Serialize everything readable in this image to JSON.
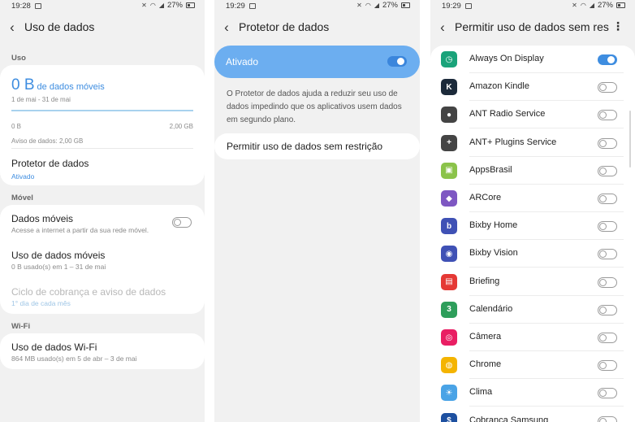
{
  "panel1": {
    "status": {
      "time": "19:28",
      "battery": "27%"
    },
    "title": "Uso de dados",
    "section_uso": "Uso",
    "usage": {
      "amount": "0 B",
      "unit_label": "de dados móveis",
      "period": "1 de mai - 31 de mai",
      "min_label": "0 B",
      "max_label": "2,00 GB",
      "warning": "Aviso de dados: 2,00 GB"
    },
    "protetor": {
      "title": "Protetor de dados",
      "status": "Ativado"
    },
    "section_movel": "Móvel",
    "dados_moveis": {
      "title": "Dados móveis",
      "subtitle": "Acesse a internet a partir da sua rede móvel.",
      "enabled": false
    },
    "uso_moveis": {
      "title": "Uso de dados móveis",
      "subtitle": "0 B usado(s) em 1 – 31 de mai"
    },
    "ciclo": {
      "title": "Ciclo de cobrança e aviso de dados",
      "subtitle": "1° dia de cada mês"
    },
    "section_wifi": "Wi-Fi",
    "wifi": {
      "title": "Uso de dados Wi-Fi",
      "subtitle": "864 MB usado(s) em 5 de abr – 3 de mai"
    }
  },
  "panel2": {
    "status": {
      "time": "19:29",
      "battery": "27%"
    },
    "title": "Protetor de dados",
    "ativado_label": "Ativado",
    "ativado_on": true,
    "description": "O Protetor de dados ajuda a reduzir seu uso de dados impedindo que os aplicativos usem dados em segundo plano.",
    "permitir_label": "Permitir uso de dados sem restrição"
  },
  "panel3": {
    "status": {
      "time": "19:29",
      "battery": "27%"
    },
    "title": "Permitir uso de dados sem rest…",
    "apps": [
      {
        "name": "Always On Display",
        "icon": "clock-icon",
        "color": "#1aa37a",
        "glyph": "◷",
        "on": true
      },
      {
        "name": "Amazon Kindle",
        "icon": "kindle-icon",
        "color": "#1c2a3a",
        "glyph": "K",
        "on": false
      },
      {
        "name": "ANT Radio Service",
        "icon": "ant-radio-icon",
        "color": "#444444",
        "glyph": "●",
        "on": false
      },
      {
        "name": "ANT+ Plugins Service",
        "icon": "ant-plugins-icon",
        "color": "#444444",
        "glyph": "+",
        "on": false
      },
      {
        "name": "AppsBrasil",
        "icon": "gift-icon",
        "color": "#8bc34a",
        "glyph": "▣",
        "on": false
      },
      {
        "name": "ARCore",
        "icon": "arcore-icon",
        "color": "#7e57c2",
        "glyph": "◆",
        "on": false
      },
      {
        "name": "Bixby Home",
        "icon": "bixby-home-icon",
        "color": "#3f51b5",
        "glyph": "b",
        "on": false
      },
      {
        "name": "Bixby Vision",
        "icon": "bixby-vision-icon",
        "color": "#3f51b5",
        "glyph": "◉",
        "on": false
      },
      {
        "name": "Briefing",
        "icon": "briefing-icon",
        "color": "#e53935",
        "glyph": "▤",
        "on": false
      },
      {
        "name": "Calendário",
        "icon": "calendar-icon",
        "color": "#2e9e5b",
        "glyph": "3",
        "on": false
      },
      {
        "name": "Câmera",
        "icon": "camera-icon",
        "color": "#e91e63",
        "glyph": "◎",
        "on": false
      },
      {
        "name": "Chrome",
        "icon": "chrome-icon",
        "color": "#f4b400",
        "glyph": "◍",
        "on": false
      },
      {
        "name": "Clima",
        "icon": "weather-icon",
        "color": "#4aa3e6",
        "glyph": "☀",
        "on": false
      },
      {
        "name": "Cobrança Samsung",
        "icon": "samsung-pay-icon",
        "color": "#1e50a0",
        "glyph": "$",
        "on": false
      }
    ]
  },
  "colors": {
    "accent": "#3e8de0",
    "ativado_bg": "#6caef0",
    "background": "#f1f1f1"
  }
}
